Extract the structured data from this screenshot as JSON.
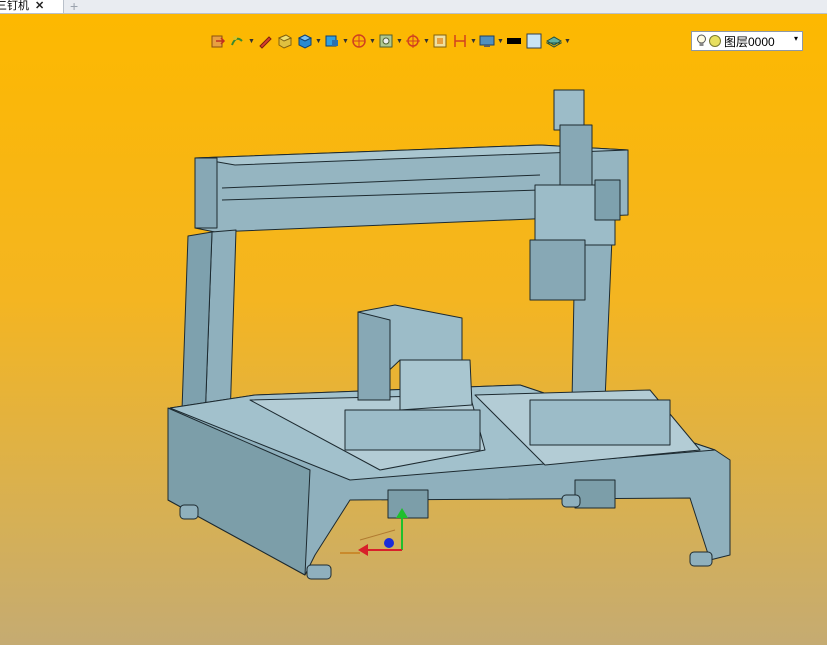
{
  "tab": {
    "title": "三钉机",
    "close_glyph": "✕",
    "add_glyph": "+"
  },
  "layer": {
    "name": "图层0000",
    "arrow": "▾"
  },
  "colors": {
    "viewport_top": "#fdb800",
    "viewport_bottom": "#c5ab72",
    "model_fill": "#8fb0bd",
    "model_edge": "#1d2a30"
  },
  "toolbar": {
    "icons": [
      "open-file-icon",
      "curve-tool-icon",
      "pen-tool-icon",
      "box-solid-icon",
      "cube-view-icon",
      "display-mode-icon",
      "section-view-icon",
      "snap-icon",
      "target-icon",
      "measure-icon",
      "dimension-icon",
      "screen-capture-icon",
      "color-black-swatch-icon",
      "color-light-swatch-icon",
      "layer-stack-icon"
    ]
  }
}
